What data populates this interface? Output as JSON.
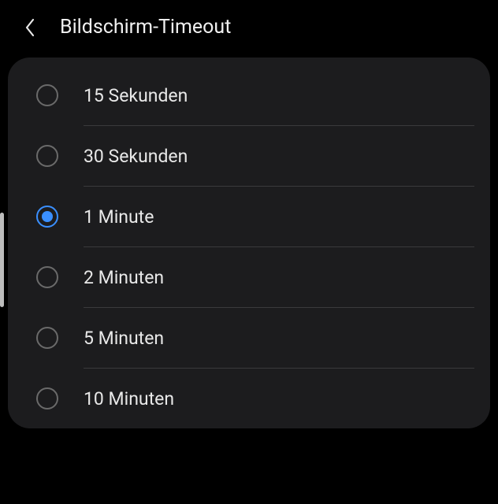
{
  "header": {
    "title": "Bildschirm-Timeout"
  },
  "options": [
    {
      "label": "15 Sekunden",
      "selected": false
    },
    {
      "label": "30 Sekunden",
      "selected": false
    },
    {
      "label": "1 Minute",
      "selected": true
    },
    {
      "label": "2 Minuten",
      "selected": false
    },
    {
      "label": "5 Minuten",
      "selected": false
    },
    {
      "label": "10 Minuten",
      "selected": false
    }
  ]
}
